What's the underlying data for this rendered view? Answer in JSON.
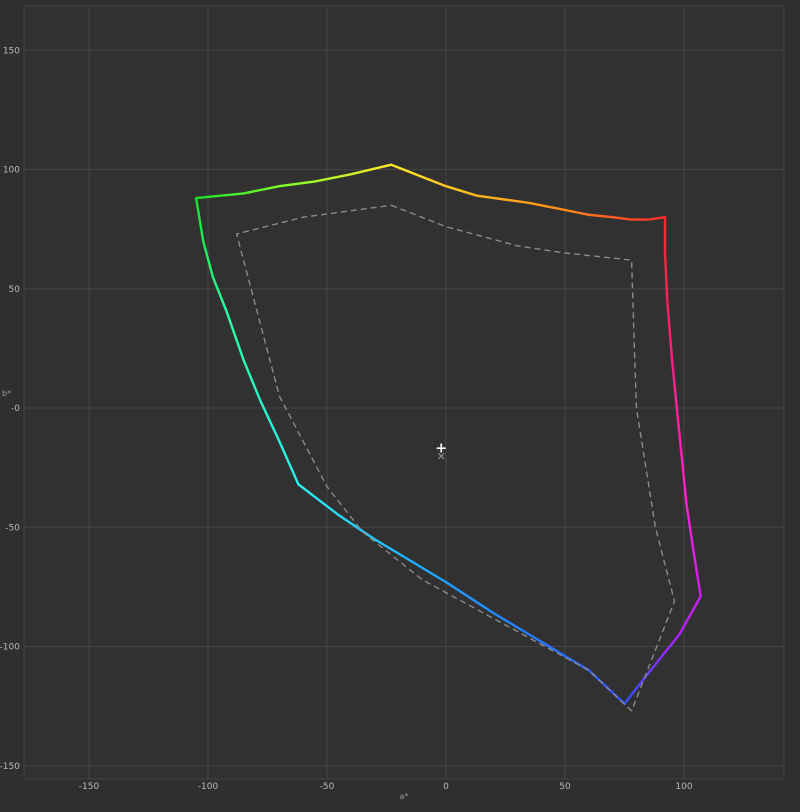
{
  "chart_data": {
    "type": "line",
    "title": "",
    "xlabel": "a*",
    "ylabel": "b*",
    "xlim": [
      -175,
      142
    ],
    "ylim": [
      -157,
      169
    ],
    "x_ticks": [
      {
        "value": -150,
        "label": "-150"
      },
      {
        "value": -100,
        "label": "-100"
      },
      {
        "value": -50,
        "label": "-50"
      },
      {
        "value": 0,
        "label": "0"
      },
      {
        "value": 50,
        "label": "50"
      },
      {
        "value": 100,
        "label": "100"
      }
    ],
    "y_ticks": [
      {
        "value": 150,
        "label": "150"
      },
      {
        "value": 100,
        "label": "100"
      },
      {
        "value": 50,
        "label": "50"
      },
      {
        "value": 0,
        "label": "-0"
      },
      {
        "value": -50,
        "label": "-50"
      },
      {
        "value": -100,
        "label": "-100"
      },
      {
        "value": -150,
        "label": "-150"
      }
    ],
    "grid": true,
    "series": [
      {
        "style": "solid-spectral",
        "segments": [
          {
            "from_color": "#ff2a2a",
            "to_color": "#ff8a1a",
            "points": [
              [
                92,
                80
              ],
              [
                85,
                79
              ],
              [
                78,
                79
              ],
              [
                70,
                80
              ],
              [
                60,
                81
              ],
              [
                50,
                83
              ]
            ]
          },
          {
            "from_color": "#ff8a1a",
            "to_color": "#ffe628",
            "points": [
              [
                50,
                83
              ],
              [
                35,
                86
              ],
              [
                13,
                89
              ],
              [
                0,
                93
              ],
              [
                -23,
                102
              ]
            ]
          },
          {
            "from_color": "#ffe628",
            "to_color": "#7cff2a",
            "points": [
              [
                -23,
                102
              ],
              [
                -40,
                98
              ],
              [
                -55,
                95
              ],
              [
                -70,
                93
              ]
            ]
          },
          {
            "from_color": "#7cff2a",
            "to_color": "#1adf2a",
            "points": [
              [
                -70,
                93
              ],
              [
                -85,
                90
              ],
              [
                -105,
                88
              ]
            ]
          },
          {
            "from_color": "#1adf2a",
            "to_color": "#2affa0",
            "points": [
              [
                -105,
                88
              ],
              [
                -102,
                70
              ],
              [
                -98,
                55
              ],
              [
                -92,
                40
              ]
            ]
          },
          {
            "from_color": "#2affa0",
            "to_color": "#2af0f0",
            "points": [
              [
                -92,
                40
              ],
              [
                -85,
                20
              ],
              [
                -78,
                3
              ],
              [
                -70,
                -14
              ],
              [
                -62,
                -32
              ]
            ]
          },
          {
            "from_color": "#2af0f0",
            "to_color": "#1f9fff",
            "points": [
              [
                -62,
                -32
              ],
              [
                -45,
                -45
              ],
              [
                -30,
                -55
              ],
              [
                -15,
                -64
              ],
              [
                0,
                -73
              ]
            ]
          },
          {
            "from_color": "#1f9fff",
            "to_color": "#3050ff",
            "points": [
              [
                0,
                -73
              ],
              [
                20,
                -86
              ],
              [
                40,
                -98
              ],
              [
                60,
                -110
              ],
              [
                75,
                -124
              ]
            ]
          },
          {
            "from_color": "#3050ff",
            "to_color": "#b21fff",
            "points": [
              [
                75,
                -124
              ],
              [
                82,
                -115
              ],
              [
                90,
                -105
              ],
              [
                98,
                -95
              ]
            ]
          },
          {
            "from_color": "#b21fff",
            "to_color": "#ff1fd6",
            "points": [
              [
                98,
                -95
              ],
              [
                107,
                -79
              ],
              [
                104,
                -60
              ],
              [
                101,
                -40
              ]
            ]
          },
          {
            "from_color": "#ff1fd6",
            "to_color": "#ff1f5a",
            "points": [
              [
                101,
                -40
              ],
              [
                98,
                -10
              ],
              [
                95,
                20
              ],
              [
                93,
                45
              ]
            ]
          },
          {
            "from_color": "#ff1f5a",
            "to_color": "#ff2a2a",
            "points": [
              [
                93,
                45
              ],
              [
                92,
                65
              ],
              [
                92,
                80
              ]
            ]
          }
        ]
      },
      {
        "style": "dashed",
        "color": "#8a8a8a",
        "points": [
          [
            -23,
            85
          ],
          [
            0,
            76
          ],
          [
            30,
            68
          ],
          [
            50,
            65
          ],
          [
            78,
            62
          ],
          [
            79,
            30
          ],
          [
            80,
            0
          ],
          [
            88,
            -50
          ],
          [
            96,
            -81
          ],
          [
            78,
            -127
          ],
          [
            60,
            -110
          ],
          [
            -10,
            -72
          ],
          [
            -35,
            -52
          ],
          [
            -50,
            -33
          ],
          [
            -70,
            5
          ],
          [
            -88,
            73
          ],
          [
            -60,
            80
          ],
          [
            -23,
            85
          ]
        ]
      }
    ],
    "markers": [
      {
        "label": "+",
        "x": -2,
        "y": -17,
        "color": "#ffffff"
      },
      {
        "label": "×",
        "x": -2,
        "y": -20,
        "color": "#8a8a8a"
      }
    ]
  }
}
